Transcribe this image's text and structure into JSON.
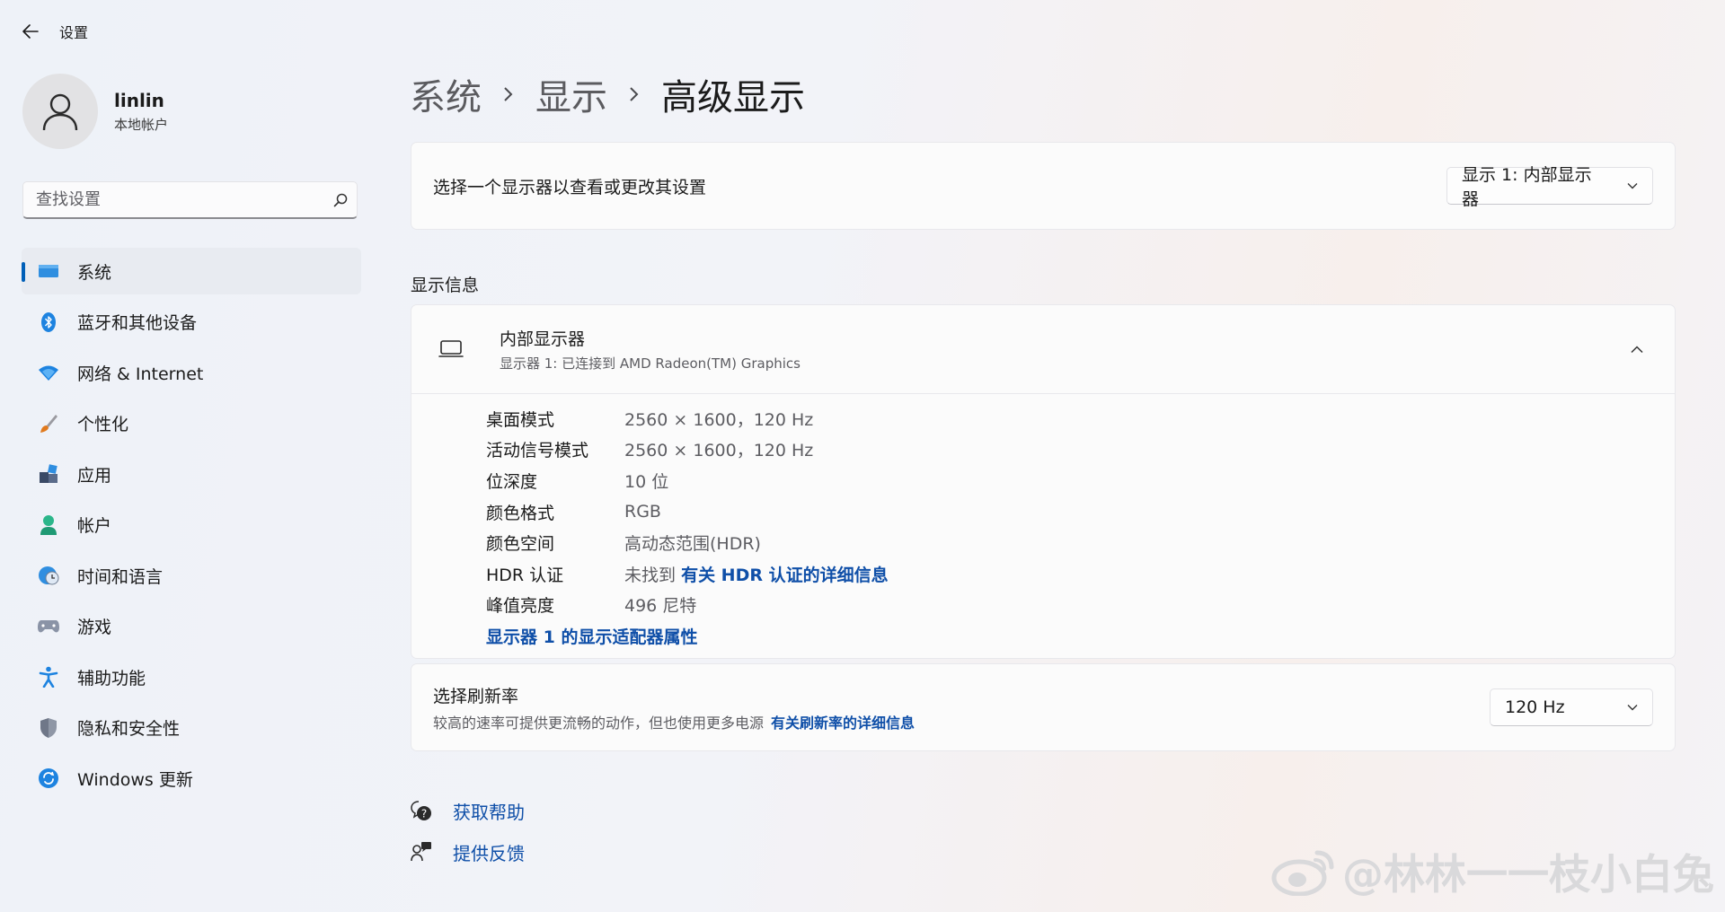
{
  "app": {
    "title": "设置"
  },
  "profile": {
    "name": "linlin",
    "account_type": "本地帐户"
  },
  "search": {
    "placeholder": "查找设置"
  },
  "nav": {
    "items": [
      {
        "label": "系统",
        "icon": "system-icon",
        "active": true
      },
      {
        "label": "蓝牙和其他设备",
        "icon": "bluetooth-icon"
      },
      {
        "label": "网络 & Internet",
        "icon": "wifi-icon"
      },
      {
        "label": "个性化",
        "icon": "brush-icon"
      },
      {
        "label": "应用",
        "icon": "apps-icon"
      },
      {
        "label": "帐户",
        "icon": "account-icon"
      },
      {
        "label": "时间和语言",
        "icon": "clock-globe-icon"
      },
      {
        "label": "游戏",
        "icon": "gamepad-icon"
      },
      {
        "label": "辅助功能",
        "icon": "accessibility-icon"
      },
      {
        "label": "隐私和安全性",
        "icon": "shield-icon"
      },
      {
        "label": "Windows 更新",
        "icon": "update-icon"
      }
    ]
  },
  "breadcrumb": {
    "items": [
      "系统",
      "显示",
      "高级显示"
    ]
  },
  "display_select": {
    "label": "选择一个显示器以查看或更改其设置",
    "value": "显示 1: 内部显示器"
  },
  "display_info": {
    "section_title": "显示信息",
    "name": "内部显示器",
    "subtitle": "显示器 1: 已连接到 AMD Radeon(TM) Graphics",
    "rows": [
      {
        "label": "桌面模式",
        "value": "2560 × 1600，120 Hz"
      },
      {
        "label": "活动信号模式",
        "value": "2560 × 1600，120 Hz"
      },
      {
        "label": "位深度",
        "value": "10 位"
      },
      {
        "label": "颜色格式",
        "value": "RGB"
      },
      {
        "label": "颜色空间",
        "value": "高动态范围(HDR)"
      },
      {
        "label": "HDR 认证",
        "value": "未找到",
        "link": "有关 HDR 认证的详细信息"
      },
      {
        "label": "峰值亮度",
        "value": "496 尼特"
      }
    ],
    "adapter_link": "显示器 1 的显示适配器属性"
  },
  "refresh": {
    "title": "选择刷新率",
    "description": "较高的速率可提供更流畅的动作，但也使用更多电源",
    "link": "有关刷新率的详细信息",
    "value": "120 Hz"
  },
  "help": {
    "get_help": "获取帮助",
    "feedback": "提供反馈"
  },
  "watermark": "@林林一一枝小白兔",
  "colors": {
    "accent": "#005fb8",
    "link": "#0f4fa8"
  }
}
